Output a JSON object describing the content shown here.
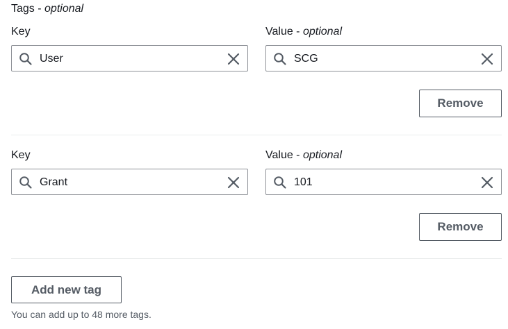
{
  "section": {
    "title": "Tags",
    "optional": "optional",
    "separator": " - "
  },
  "tags": [
    {
      "key_label": "Key",
      "value_label": "Value",
      "value_optional": "optional",
      "key": "User",
      "value": "SCG",
      "remove_label": "Remove"
    },
    {
      "key_label": "Key",
      "value_label": "Value",
      "value_optional": "optional",
      "key": "Grant",
      "value": "101",
      "remove_label": "Remove"
    }
  ],
  "add_button_label": "Add new tag",
  "hint": "You can add up to 48 more tags.",
  "icons": {
    "search": "search-icon",
    "clear": "close-icon"
  },
  "colors": {
    "text": "#16191f",
    "border": "#8d9096",
    "button_border": "#545b64",
    "divider": "#eaeded",
    "hint": "#545b64"
  }
}
